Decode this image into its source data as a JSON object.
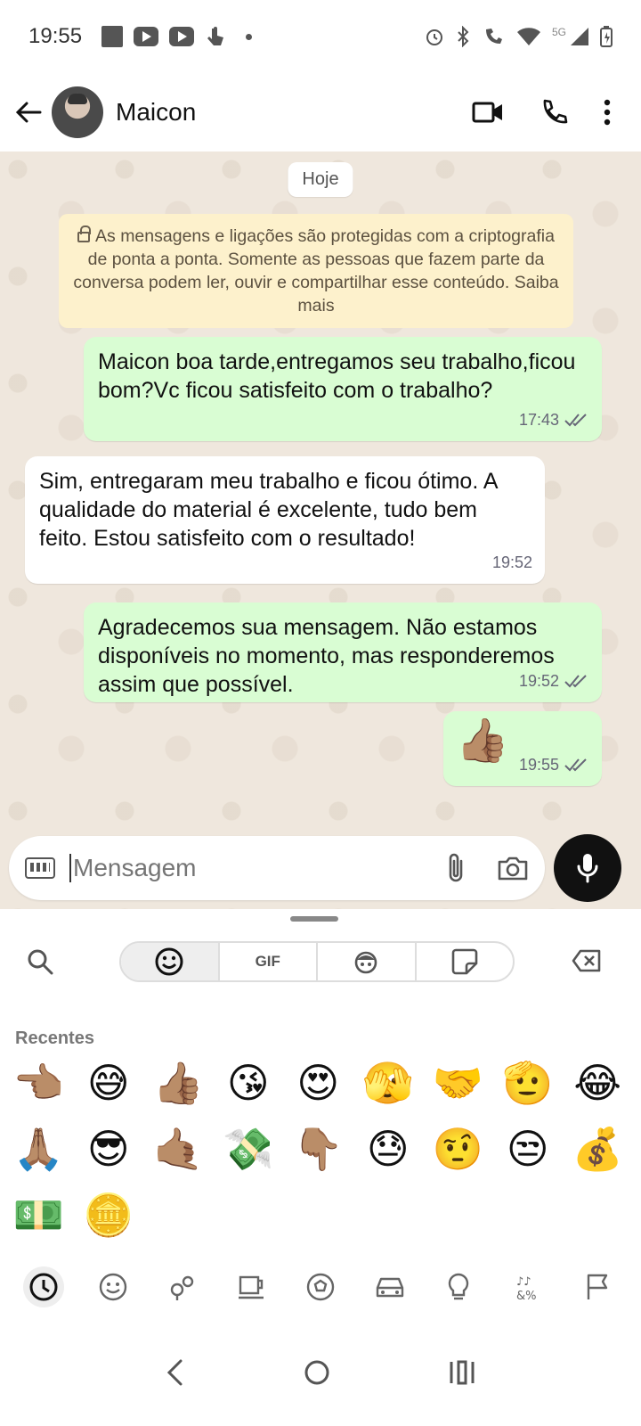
{
  "status": {
    "time": "19:55",
    "net": "5G"
  },
  "header": {
    "contact_name": "Maicon"
  },
  "chat": {
    "date_chip": "Hoje",
    "encryption_notice": "As mensagens e ligações são protegidas com a criptografia de ponta a ponta. Somente as pessoas que fazem parte da conversa podem ler, ouvir e compartilhar esse conteúdo. Saiba mais",
    "messages": [
      {
        "direction": "out",
        "text": "Maicon boa tarde,entregamos seu trabalho,ficou bom?Vc ficou satisfeito com o trabalho?",
        "time": "17:43"
      },
      {
        "direction": "in",
        "text": "Sim, entregaram meu trabalho e ficou ótimo. A qualidade do material é excelente, tudo bem feito. Estou  satisfeito com o resultado!",
        "time": "19:52"
      },
      {
        "direction": "out",
        "text": "Agradecemos sua mensagem. Não estamos disponíveis no momento, mas responderemos assim que possível.",
        "time": "19:52"
      },
      {
        "direction": "out",
        "text": "👍🏽",
        "time": "19:55"
      }
    ]
  },
  "input": {
    "placeholder": "Mensagem"
  },
  "emoji_panel": {
    "tabs": [
      "emoji",
      "GIF",
      "avatar",
      "sticker"
    ],
    "gif_label": "GIF",
    "section_title": "Recentes",
    "recent": [
      "👈🏽",
      "😅",
      "👍🏽",
      "😘",
      "😍",
      "🫣",
      "🤝",
      "🫡",
      "😂",
      "🙏🏽",
      "😎",
      "🤙🏽",
      "💸",
      "👇🏽",
      "😓",
      "🤨",
      "😒",
      "💰",
      "💵",
      "🪙"
    ]
  },
  "colors": {
    "outgoing_bubble": "#d9fdd3",
    "incoming_bubble": "#ffffff",
    "chat_bg": "#efe7dd",
    "notice_bg": "#fdf1cc"
  }
}
